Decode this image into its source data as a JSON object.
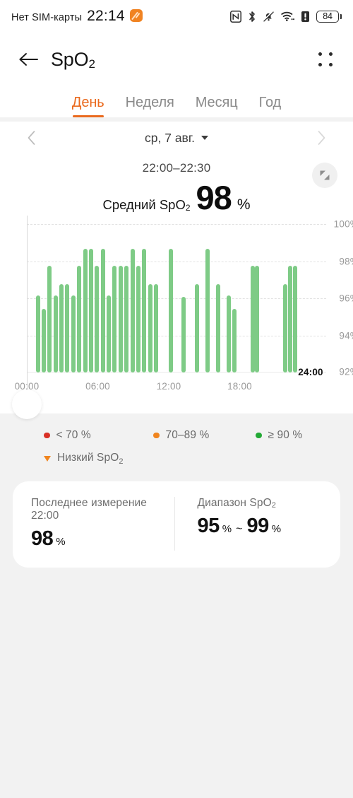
{
  "status_bar": {
    "carrier": "Нет SIM-карты",
    "time": "22:14",
    "icons": [
      "nfc-icon",
      "bluetooth-icon",
      "mute-icon",
      "wifi-icon",
      "alert-icon"
    ],
    "battery_level": "84"
  },
  "app_bar": {
    "back": "back-arrow-icon",
    "title": "SpO",
    "title_sub": "2",
    "menu": "grid-dots-icon"
  },
  "tabs": [
    {
      "label": "День",
      "active": true
    },
    {
      "label": "Неделя",
      "active": false
    },
    {
      "label": "Месяц",
      "active": false
    },
    {
      "label": "Год",
      "active": false
    }
  ],
  "date_nav": {
    "prev": "chevron-left-icon",
    "date": "ср, 7 авг.",
    "next": "chevron-right-icon"
  },
  "summary": {
    "time_range": "22:00–22:30",
    "avg_label": "Средний SpO",
    "avg_label_sub": "2",
    "avg_value": "98",
    "avg_unit": "%",
    "expand": "expand-icon"
  },
  "legend": {
    "items": [
      {
        "label": "< 70 %",
        "color": "#d93025"
      },
      {
        "label": "70–89 %",
        "color": "#f0851f"
      },
      {
        "label": "≥ 90 %",
        "color": "#23a935"
      }
    ],
    "low_marker": {
      "label": "Низкий SpO",
      "label_sub": "2",
      "color": "#f0851f"
    }
  },
  "bottom_card": {
    "last": {
      "label": "Последнее измерение 22:00",
      "value": "98",
      "unit": "%"
    },
    "range": {
      "label": "Диапазон SpO",
      "label_sub": "2",
      "min": "95",
      "min_unit": "%",
      "sep": "~",
      "max": "99",
      "max_unit": "%"
    }
  },
  "colors": {
    "accent": "#ea6a1e",
    "bar": "#7ecb86",
    "bar_current": "#2fbe3f",
    "background": "#f2f2f2",
    "surface": "#ffffff"
  },
  "chart_data": {
    "type": "bar",
    "title": "SpO2 за день",
    "xlabel": "",
    "ylabel": "%",
    "ylim": [
      91,
      100.6
    ],
    "yticks": [
      92,
      94,
      96,
      98,
      100
    ],
    "ytick_labels": [
      "92%",
      "94%",
      "96%",
      "98%",
      "100%"
    ],
    "grid": true,
    "xticks": [
      0,
      6,
      12,
      18,
      24
    ],
    "xtick_labels": [
      "00:00",
      "06:00",
      "12:00",
      "18:00",
      "24:00"
    ],
    "x_axis_hours": [
      0,
      24
    ],
    "highlight_index": 33,
    "legend_position": "below",
    "x": [
      0.75,
      1.25,
      1.75,
      2.25,
      2.75,
      3.25,
      3.75,
      4.25,
      4.75,
      5.25,
      5.75,
      6.25,
      6.75,
      7.25,
      7.75,
      8.25,
      8.75,
      9.25,
      9.75,
      10.25,
      10.75,
      12.0,
      13.1,
      14.2,
      15.1,
      16.0,
      16.9,
      17.4,
      18.9,
      19.3,
      21.7,
      22.1,
      22.5
    ],
    "values": [
      96.0,
      95.1,
      97.9,
      96.0,
      96.7,
      96.7,
      96.0,
      97.9,
      99.0,
      99.0,
      97.9,
      99.0,
      96.0,
      97.9,
      97.9,
      97.9,
      99.0,
      97.9,
      99.0,
      96.7,
      96.7,
      99.0,
      95.9,
      96.7,
      99.0,
      96.7,
      96.0,
      95.1,
      97.9,
      97.9,
      96.7,
      97.9,
      97.9
    ],
    "series": [
      {
        "name": "SpO2",
        "unit": "%",
        "values": [
          96.0,
          95.1,
          97.9,
          96.0,
          96.7,
          96.7,
          96.0,
          97.9,
          99.0,
          99.0,
          97.9,
          99.0,
          96.0,
          97.9,
          97.9,
          97.9,
          99.0,
          97.9,
          99.0,
          96.7,
          96.7,
          99.0,
          95.9,
          96.7,
          99.0,
          96.7,
          96.0,
          95.1,
          97.9,
          97.9,
          96.7,
          97.9,
          97.9
        ]
      }
    ]
  }
}
